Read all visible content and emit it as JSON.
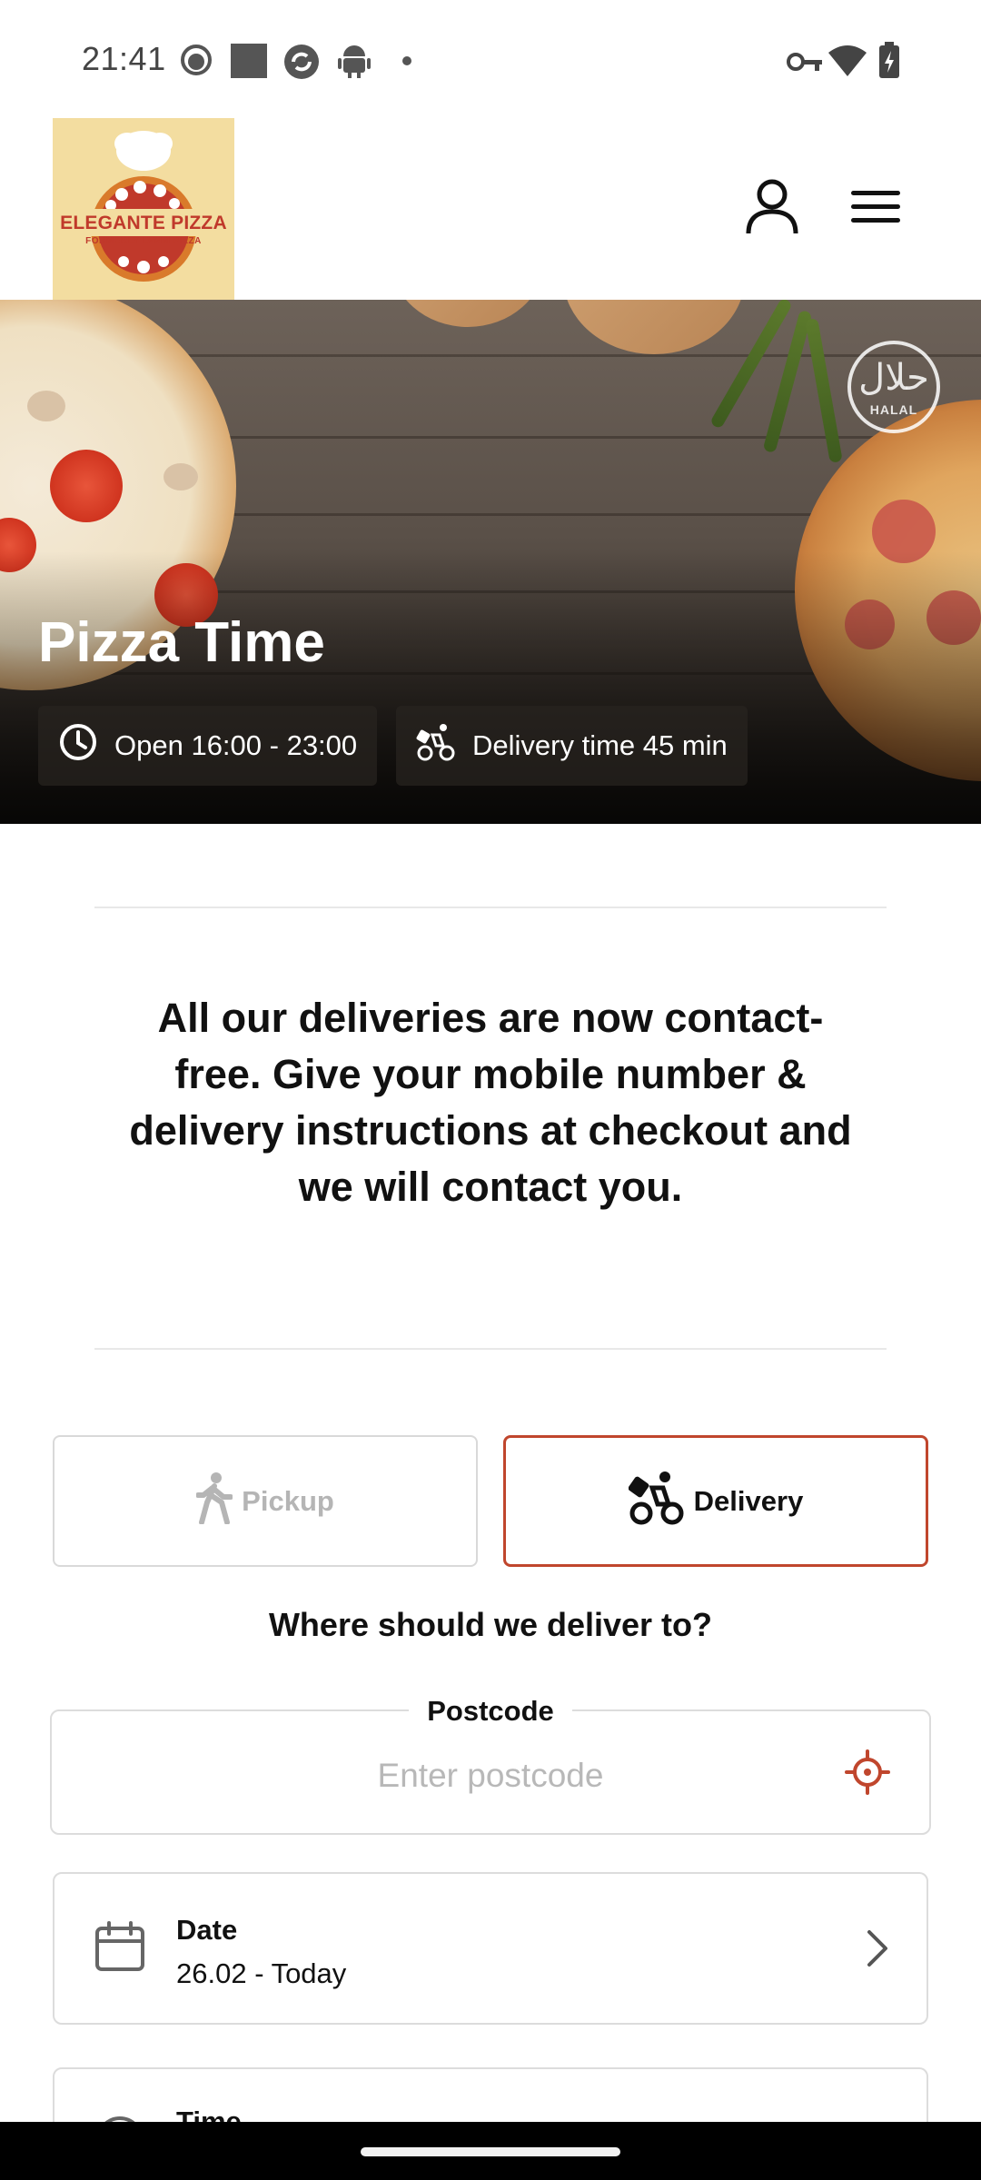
{
  "status_bar": {
    "time": "21:41",
    "icons_left": [
      "face-notification-icon",
      "image-notification-icon",
      "sync-notification-icon",
      "android-notification-icon",
      "dot-icon"
    ],
    "icons_right": [
      "vpn-key-icon",
      "wifi-icon",
      "battery-charging-icon"
    ]
  },
  "header": {
    "logo_name": "ELEGANTE PIZZA",
    "logo_tagline": "FORMERLY LVMM PIZZA",
    "account_icon": "person-icon",
    "menu_icon": "hamburger-menu-icon"
  },
  "hero": {
    "shop_name": "Pizza Time",
    "halal_arabic": "حلال",
    "halal_label": "HALAL",
    "opening_hours": "Open 16:00 - 23:00",
    "delivery_time": "Delivery time 45 min"
  },
  "notice": {
    "text": "All our deliveries are now contact-free. Give your mobile number & delivery instructions at checkout and we will contact you."
  },
  "order_mode": {
    "pickup_label": "Pickup",
    "delivery_label": "Delivery",
    "selected": "Delivery",
    "accent_color": "#c0462d"
  },
  "address": {
    "question": "Where should we deliver to?",
    "postcode_label": "Postcode",
    "postcode_placeholder": "Enter postcode",
    "postcode_value": "",
    "locate_icon": "crosshair-locate-icon"
  },
  "date_card": {
    "title": "Date",
    "value": "26.02 - Today"
  },
  "time_card": {
    "title": "Time"
  }
}
